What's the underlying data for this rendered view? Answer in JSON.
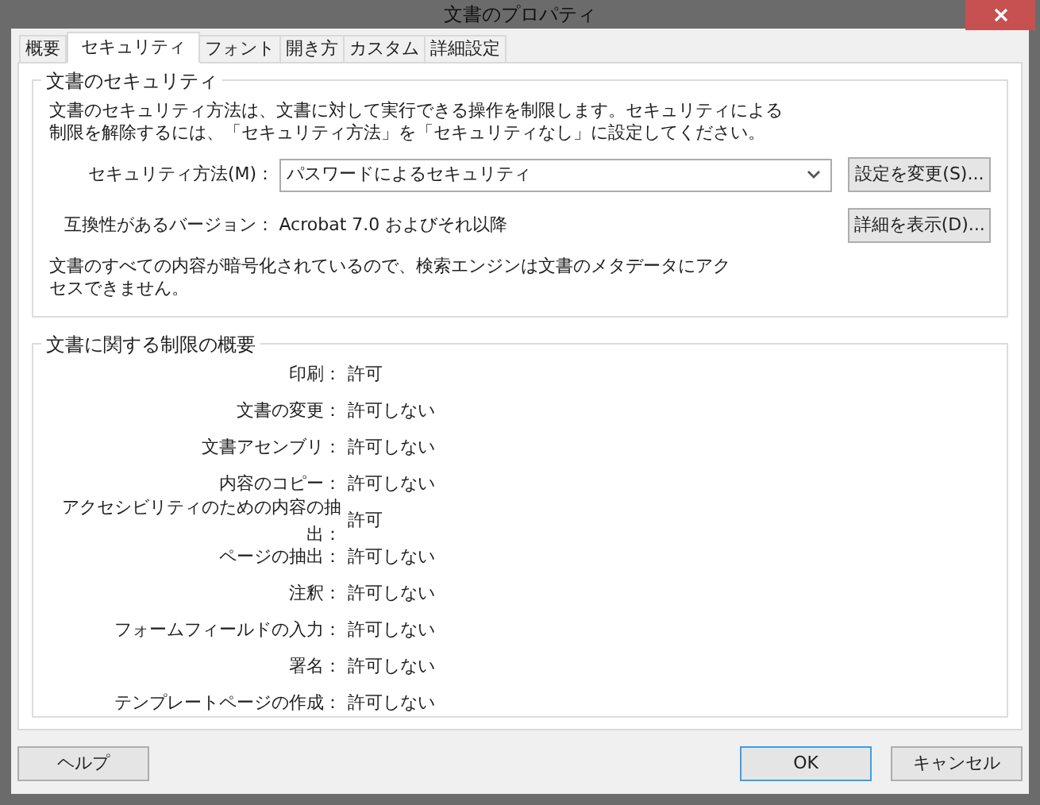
{
  "window": {
    "title": "文書のプロパティ"
  },
  "tabs": [
    {
      "label": "概要",
      "selected": false
    },
    {
      "label": "セキュリティ",
      "selected": true
    },
    {
      "label": "フォント",
      "selected": false
    },
    {
      "label": "開き方",
      "selected": false
    },
    {
      "label": "カスタム",
      "selected": false
    },
    {
      "label": "詳細設定",
      "selected": false
    }
  ],
  "security": {
    "title": "文書のセキュリティ",
    "description": "文書のセキュリティ方法は、文書に対して実行できる操作を制限します。セキュリティによる制限を解除するには、「セキュリティ方法」を「セキュリティなし」に設定してください。",
    "method_label": "セキュリティ方法(M)：",
    "method_value": "パスワードによるセキュリティ",
    "change_button": "設定を変更(S)...",
    "compat_label": "互換性があるバージョン：",
    "compat_value": "Acrobat 7.0 およびそれ以降",
    "details_button": "詳細を表示(D)...",
    "note": "文書のすべての内容が暗号化されているので、検索エンジンは文書のメタデータにアクセスできません。"
  },
  "restrictions": {
    "title": "文書に関する制限の概要",
    "rows": [
      {
        "label": "印刷：",
        "value": "許可"
      },
      {
        "label": "文書の変更：",
        "value": "許可しない"
      },
      {
        "label": "文書アセンブリ：",
        "value": "許可しない"
      },
      {
        "label": "内容のコピー：",
        "value": "許可しない"
      },
      {
        "label": "アクセシビリティのための内容の抽出：",
        "value": "許可"
      },
      {
        "label": "ページの抽出：",
        "value": "許可しない"
      },
      {
        "label": "注釈：",
        "value": "許可しない"
      },
      {
        "label": "フォームフィールドの入力：",
        "value": "許可しない"
      },
      {
        "label": "署名：",
        "value": "許可しない"
      },
      {
        "label": "テンプレートページの作成：",
        "value": "許可しない"
      }
    ]
  },
  "buttons": [
    {
      "label": "ヘルプ",
      "default": false
    },
    {
      "label": "OK",
      "default": true
    },
    {
      "label": "キャンセル",
      "default": false
    }
  ]
}
